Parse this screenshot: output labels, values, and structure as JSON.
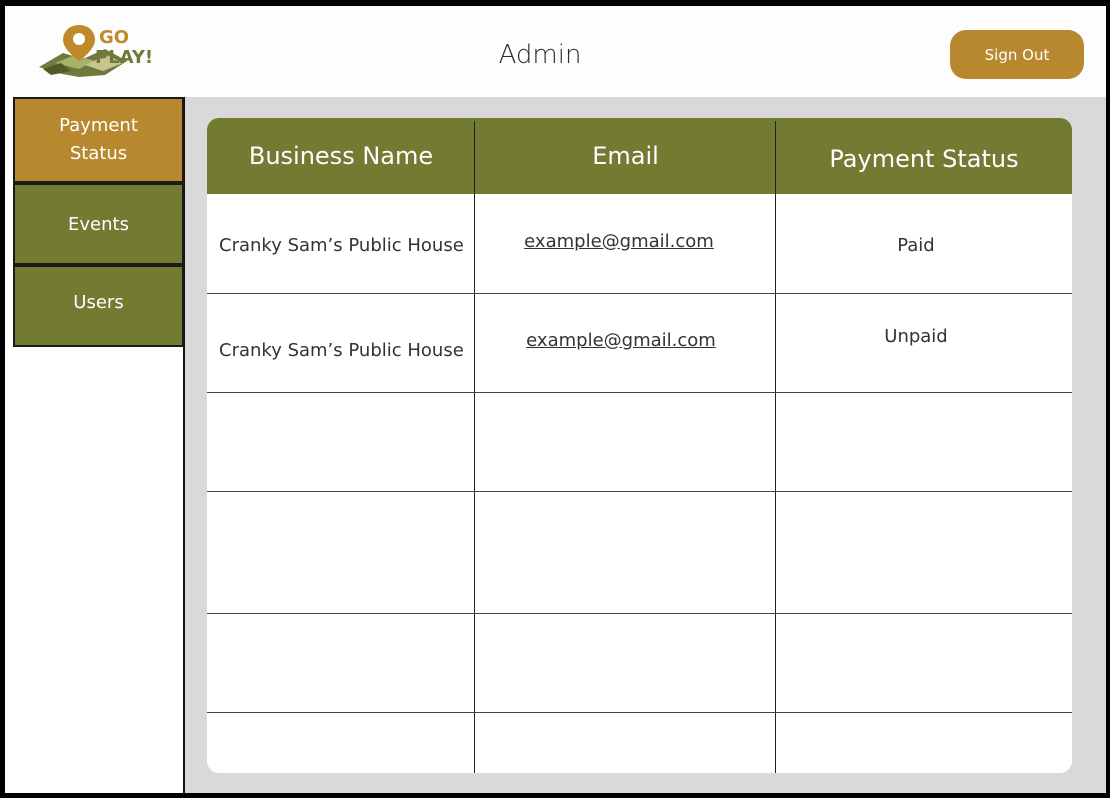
{
  "header": {
    "logo_text_line1": "GO",
    "logo_text_line2": "PLAY!",
    "title": "Admin",
    "sign_out_label": "Sign Out"
  },
  "sidebar": {
    "items": [
      {
        "label_line1": "Payment",
        "label_line2": "Status",
        "active": true
      },
      {
        "label": "Events",
        "active": false
      },
      {
        "label": "Users",
        "active": false
      }
    ]
  },
  "table": {
    "columns": [
      "Business Name",
      "Email",
      "Payment Status"
    ],
    "rows": [
      {
        "business": "Cranky Sam’s Public House",
        "email": "example@gmail.com",
        "status": "Paid"
      },
      {
        "business": "Cranky Sam’s Public House",
        "email": "example@gmail.com",
        "status": "Unpaid"
      }
    ]
  },
  "colors": {
    "accent_gold": "#b8882e",
    "olive": "#737a32",
    "background": "#d9d9d9"
  }
}
